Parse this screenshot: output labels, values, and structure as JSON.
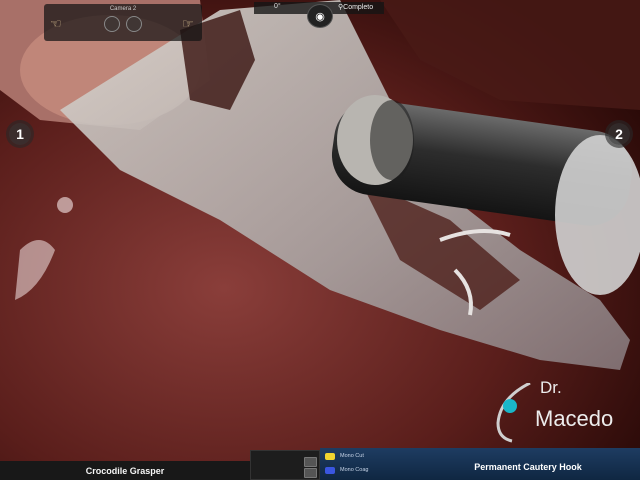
{
  "hud": {
    "camera_label": "Camera 2",
    "angle": "0°",
    "view_mode": "Completo"
  },
  "arms": {
    "left_number": "1",
    "right_number": "2"
  },
  "instruments": {
    "left": "Crocodile Grasper",
    "right": "Permanent Cautery Hook",
    "modes": [
      {
        "label": "Mono Cut",
        "color": "#f0d430"
      },
      {
        "label": "Mono Coag",
        "color": "#3a56e0"
      }
    ]
  },
  "watermark": {
    "prefix": "Dr.",
    "name": "Macedo"
  },
  "icons": {
    "hand_left": "hand-icon",
    "hand_right": "hand-icon",
    "camera": "camera-icon"
  }
}
